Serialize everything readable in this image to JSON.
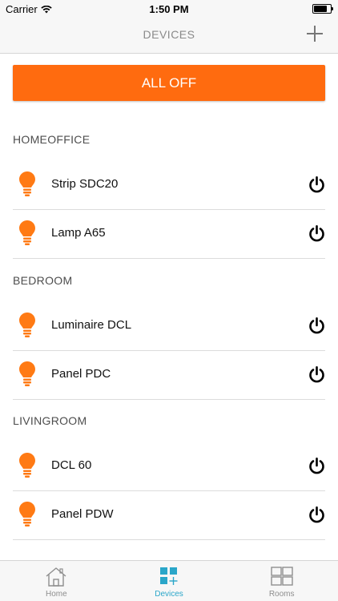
{
  "status_bar": {
    "carrier": "Carrier",
    "time": "1:50 PM"
  },
  "nav": {
    "title": "DEVICES",
    "add_icon": "plus-icon"
  },
  "all_off_label": "ALL OFF",
  "colors": {
    "accent": "#ff6b0f",
    "bulb": "#ff7a14",
    "tab_active": "#2aa6c9",
    "tab_inactive": "#8e8e8e"
  },
  "groups": [
    {
      "name": "HOMEOFFICE",
      "devices": [
        {
          "label": "Strip SDC20",
          "icon": "bulb-icon"
        },
        {
          "label": "Lamp A65",
          "icon": "bulb-icon"
        }
      ]
    },
    {
      "name": "BEDROOM",
      "devices": [
        {
          "label": "Luminaire DCL",
          "icon": "bulb-icon"
        },
        {
          "label": "Panel PDC",
          "icon": "bulb-icon"
        }
      ]
    },
    {
      "name": "LIVINGROOM",
      "devices": [
        {
          "label": "DCL 60",
          "icon": "bulb-icon"
        },
        {
          "label": "Panel PDW",
          "icon": "bulb-icon"
        }
      ]
    }
  ],
  "tabs": [
    {
      "label": "Home",
      "icon": "home-icon",
      "active": false
    },
    {
      "label": "Devices",
      "icon": "devices-icon",
      "active": true
    },
    {
      "label": "Rooms",
      "icon": "rooms-icon",
      "active": false
    }
  ]
}
